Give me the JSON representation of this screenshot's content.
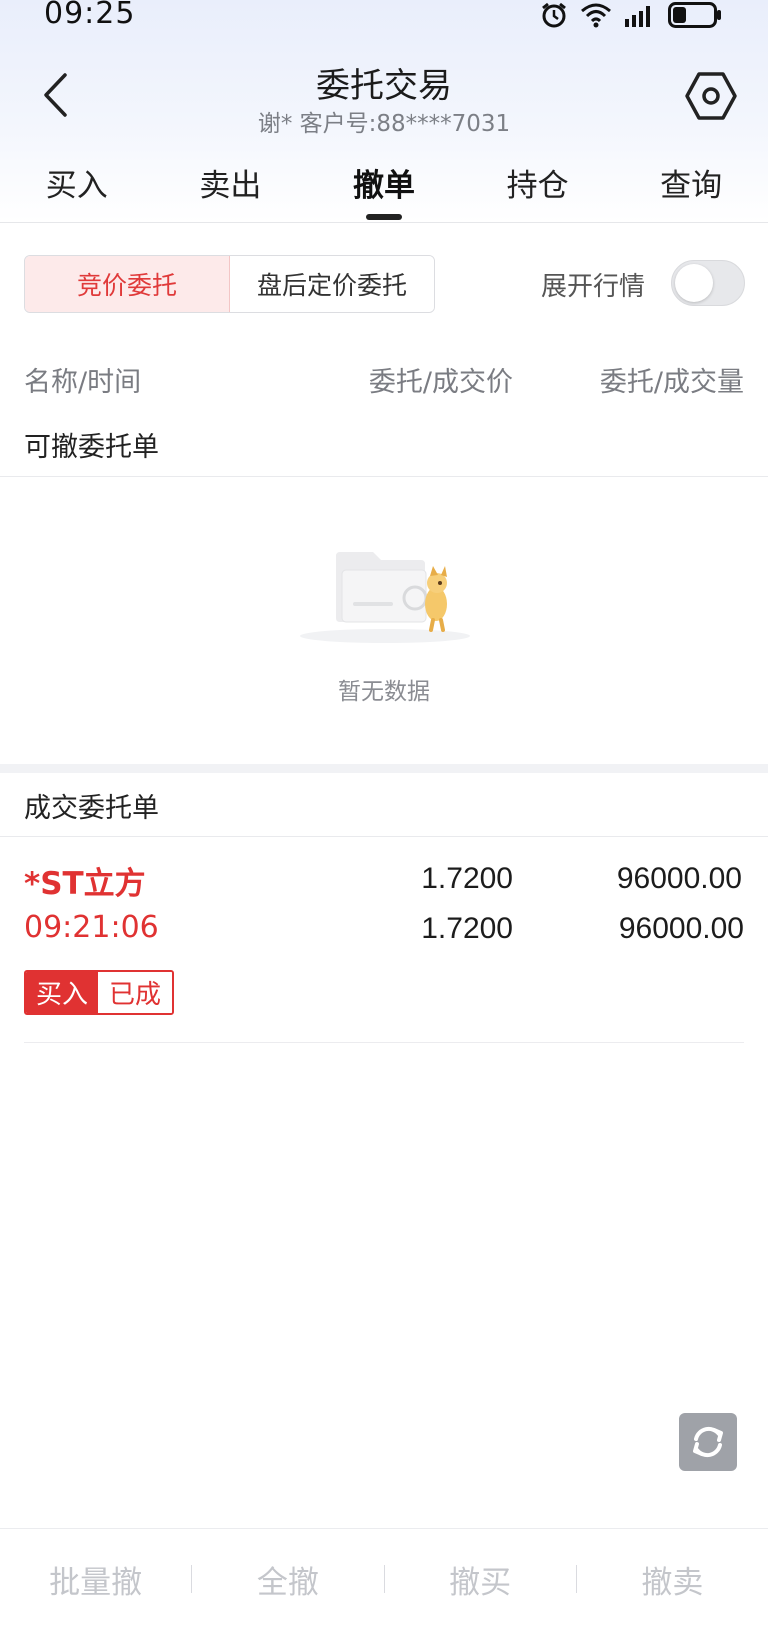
{
  "status_bar": {
    "time": "09:25"
  },
  "header": {
    "title": "委托交易",
    "subtitle": "谢* 客户号:88****7031"
  },
  "tabs": [
    {
      "label": "买入"
    },
    {
      "label": "卖出"
    },
    {
      "label": "撤单",
      "active": true
    },
    {
      "label": "持仓"
    },
    {
      "label": "查询"
    }
  ],
  "segment": {
    "options": [
      "竞价委托",
      "盘后定价委托"
    ],
    "selected": "竞价委托"
  },
  "expand_quotes": {
    "label": "展开行情",
    "on": false
  },
  "columns": {
    "name": "名称/时间",
    "price": "委托/成交价",
    "qty": "委托/成交量"
  },
  "cancelable_section": {
    "title": "可撤委托单",
    "empty_text": "暂无数据"
  },
  "filled_section": {
    "title": "成交委托单",
    "orders": [
      {
        "name": "*ST立方",
        "time": "09:21:06",
        "order_price": "1.7200",
        "fill_price": "1.7200",
        "order_qty": "96000.00",
        "fill_qty": "96000.00",
        "side": "买入",
        "status": "已成"
      }
    ]
  },
  "bottom_bar": {
    "batch_cancel": "批量撤",
    "cancel_all": "全撤",
    "cancel_buy": "撤买",
    "cancel_sell": "撤卖"
  },
  "colors": {
    "accent_red": "#e03232",
    "segment_active_bg": "#fdeaea",
    "disabled_text": "#c4c6cb"
  },
  "icons": {
    "back": "chevron-left-icon",
    "settings": "hexagon-settings-icon",
    "refresh": "refresh-icon",
    "empty": "empty-folder-illustration"
  }
}
